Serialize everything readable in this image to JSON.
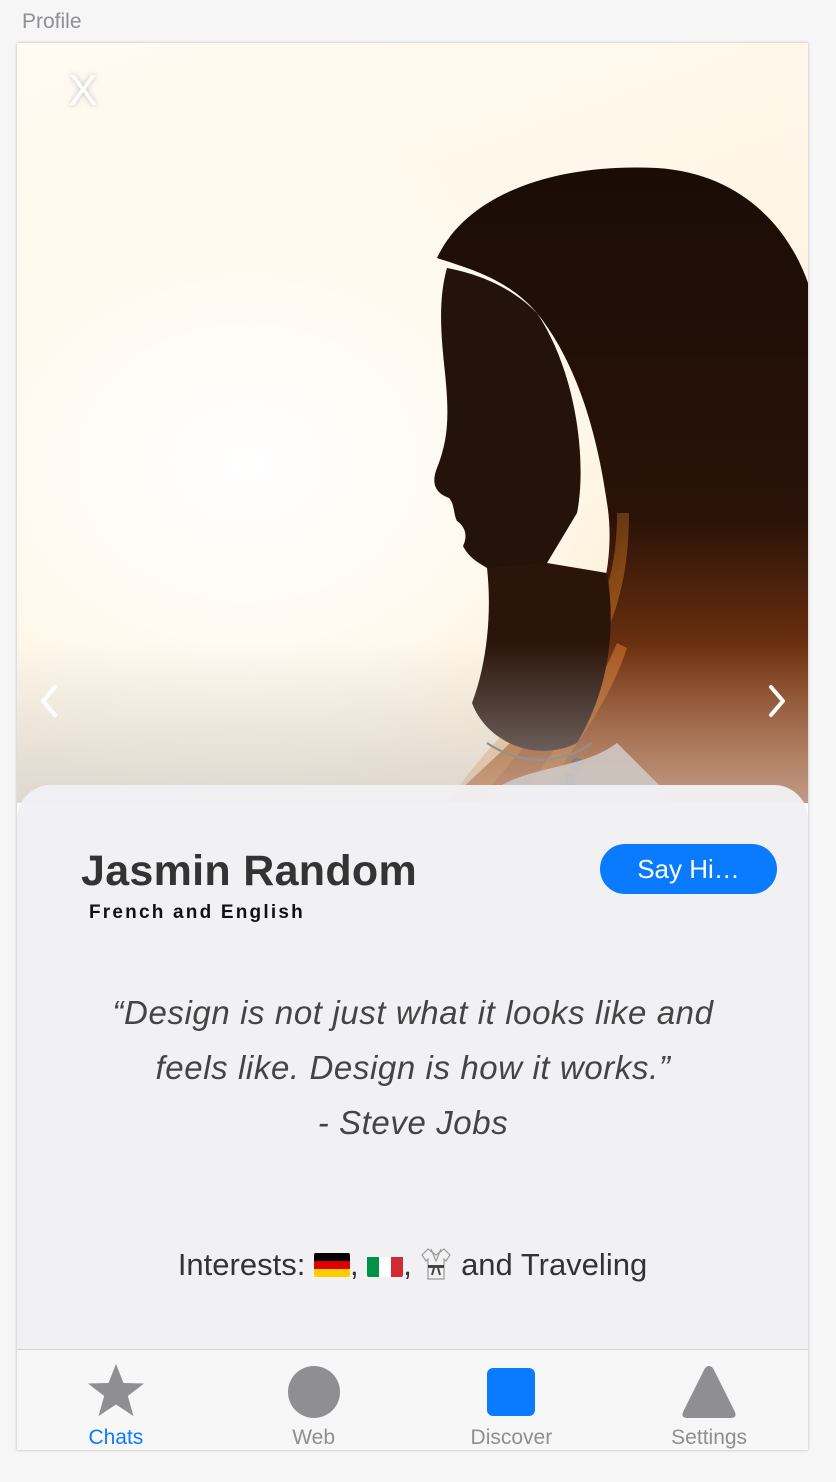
{
  "page": {
    "label": "Profile"
  },
  "photo": {
    "close_label": "X",
    "prev_icon": "chevron-left-icon",
    "next_icon": "chevron-right-icon"
  },
  "profile": {
    "name": "Jasmin Random",
    "languages": "French and English",
    "say_hi_label": "Say Hi…",
    "quote_line1": "“Design is not just what it looks like and",
    "quote_line2": "feels like. Design is how it works.”",
    "quote_author": "- Steve Jobs",
    "interests_prefix": "Interests:",
    "interests_sep1": ",",
    "interests_sep2": ",",
    "interests_suffix": "and Traveling",
    "interest_icons": [
      "germany-flag-icon",
      "italy-flag-icon",
      "martial-arts-uniform-icon"
    ]
  },
  "tabbar": {
    "active": "Chats",
    "tabs": [
      {
        "label": "Chats",
        "icon": "star-icon"
      },
      {
        "label": "Web",
        "icon": "circle-icon"
      },
      {
        "label": "Discover",
        "icon": "square-icon"
      },
      {
        "label": "Settings",
        "icon": "triangle-icon"
      }
    ]
  },
  "colors": {
    "accent": "#0a7bff",
    "inactive_tab": "#8e8e93",
    "card_bg": "#f0f0f2"
  }
}
